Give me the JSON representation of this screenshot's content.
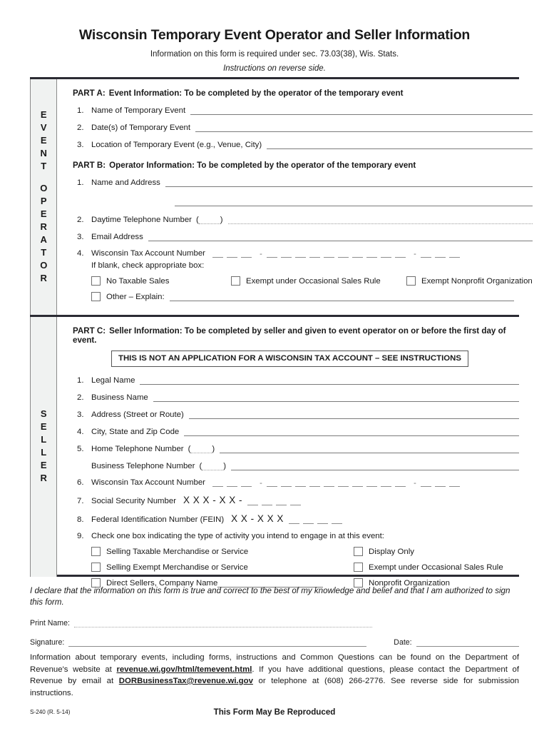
{
  "header": {
    "title": "Wisconsin Temporary Event Operator and Seller Information",
    "subtitle": "Information on this form is required under sec. 73.03(38), Wis. Stats.",
    "instructions": "Instructions on reverse side."
  },
  "sidebars": {
    "operator_line1": "EVENT",
    "operator_line2": "OPERATOR",
    "seller": "SELLER"
  },
  "part_a": {
    "label": "PART A:",
    "heading": "Event Information:  To be completed by the operator of the temporary event",
    "items": [
      {
        "num": "1.",
        "label": "Name of Temporary Event"
      },
      {
        "num": "2.",
        "label": "Date(s) of Temporary Event"
      },
      {
        "num": "3.",
        "label": "Location of Temporary Event (e.g., Venue, City)"
      }
    ]
  },
  "part_b": {
    "label": "PART B:",
    "heading": "Operator Information:  To be completed by the operator of the temporary event",
    "item1_num": "1.",
    "item1_label": "Name and Address",
    "item2_num": "2.",
    "item2_label": "Daytime Telephone Number",
    "item3_num": "3.",
    "item3_label": "Email Address",
    "item4_num": "4.",
    "item4_label": "Wisconsin Tax Account Number",
    "if_blank": "If blank, check appropriate box:",
    "checkboxes": [
      "No Taxable Sales",
      "Exempt under Occasional Sales Rule",
      "Exempt Nonprofit Organization",
      "Other – Explain:"
    ]
  },
  "part_c": {
    "label": "PART C:",
    "heading": "Seller Information:  To be completed by seller and given to event operator on or before the first day of event.",
    "callout": "THIS IS NOT AN APPLICATION FOR A WISCONSIN TAX ACCOUNT – SEE INSTRUCTIONS",
    "items": [
      {
        "num": "1.",
        "label": "Legal Name"
      },
      {
        "num": "2.",
        "label": "Business Name"
      },
      {
        "num": "3.",
        "label": "Address (Street or Route)"
      },
      {
        "num": "4.",
        "label": "City, State and Zip Code"
      }
    ],
    "item5_num": "5.",
    "item5_label": "Home Telephone Number",
    "item5b_label": "Business Telephone Number",
    "item6_num": "6.",
    "item6_label": "Wisconsin Tax Account Number",
    "item7_num": "7.",
    "item7_label": "Social Security Number",
    "ssn_mask": "X X X - X X -",
    "item8_num": "8.",
    "item8_label": "Federal Identification Number (FEIN)",
    "fein_mask": "X X - X X X",
    "item9_num": "9.",
    "item9_label": "Check one box indicating the type of activity you intend to engage in at this event:",
    "activity_left": [
      "Selling Taxable Merchandise or Service",
      "Selling Exempt Merchandise or Service",
      "Direct Sellers, Company Name"
    ],
    "activity_right": [
      "Display Only",
      "Exempt under Occasional Sales Rule",
      "Nonprofit Organization"
    ]
  },
  "declaration": {
    "text": "I declare that the information on this form is true and correct to the best of my knowledge and belief and that I am authorized to sign this form.",
    "print_name_label": "Print Name:",
    "signature_label": "Signature:",
    "date_label": "Date:"
  },
  "footer": {
    "line_part1": "Information about temporary events, including forms, instructions and Common Questions can be found on the Department of Revenue's website at ",
    "website": "revenue.wi.gov/html/temevent.html",
    "line_part2": ".  If you have additional questions, please contact the Department of Revenue by email at ",
    "email": "DORBusinessTax@revenue.wi.gov",
    "line_part3": " or telephone at (608) 266-2776.  See reverse side for submission instructions.",
    "form_number": "S-240 (R. 5-14)",
    "reproduce": "This Form May Be Reproduced"
  }
}
